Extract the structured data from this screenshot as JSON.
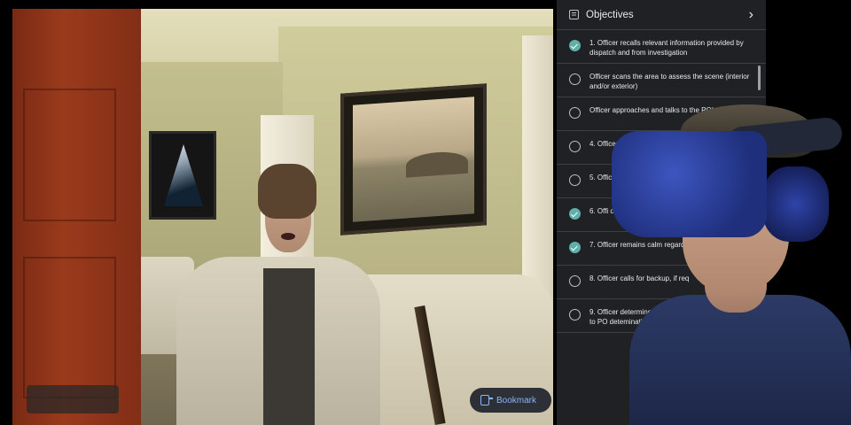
{
  "scene": {
    "bookmark_label": "Bookmark"
  },
  "objectives": {
    "title": "Objectives",
    "items": [
      {
        "text": "1. Officer recalls relevant information provided by dispatch and from investigation",
        "completed": true
      },
      {
        "text": "Officer scans the area to assess the scene (interior and/or exterior)",
        "completed": false
      },
      {
        "text": "Officer approaches and talks to the POI to investigate",
        "completed": false
      },
      {
        "text": "4. Officer maintains a safe areas of c",
        "completed": false
      },
      {
        "text": "5. Offic respo",
        "completed": false
      },
      {
        "text": "6. Offi commu",
        "completed": true
      },
      {
        "text": "7. Officer remains calm regard of aggravation",
        "completed": true
      },
      {
        "text": "8. Officer calls for backup, if req",
        "completed": false
      },
      {
        "text": "9. Officer determines DV situat appropriate resources to PO detemination",
        "completed": false
      }
    ]
  },
  "colors": {
    "panel_bg": "#202124",
    "check_done": "#5fb0a8",
    "bookmark_accent": "#8ab4f8"
  }
}
